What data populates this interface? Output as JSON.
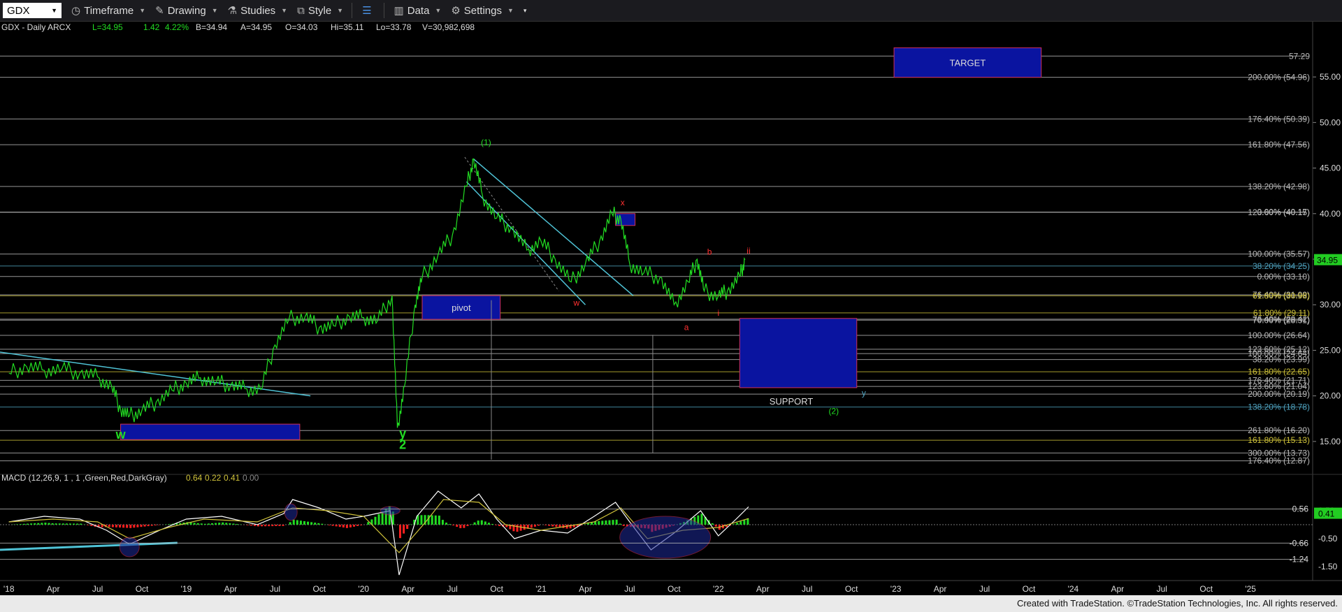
{
  "toolbar": {
    "symbol": "GDX",
    "timeframe": "Timeframe",
    "drawing": "Drawing",
    "studies": "Studies",
    "style": "Style",
    "data": "Data",
    "settings": "Settings"
  },
  "header": {
    "symbol_desc": "GDX - Daily  ARCX",
    "l": "L=34.95",
    "chg": "1.42",
    "pct": "4.22%",
    "b": "B=34.94",
    "a": "A=34.95",
    "o": "O=34.03",
    "hi": "Hi=35.11",
    "lo": "Lo=33.78",
    "v": "V=30,982,698"
  },
  "macd_header": {
    "label": "MACD (12,26,9, 1 , 1 ,Green,Red,DarkGray)",
    "v1": "0.64",
    "v2": "0.22",
    "v3": "0.41",
    "v4": "0.00"
  },
  "footer": "Created with TradeStation. ©TradeStation Technologies, Inc. All rights reserved.",
  "colors": {
    "price": "#22dd22",
    "fib_gray": "#bbbbbb",
    "fib_blue": "#4fa3c0",
    "fib_yellow": "#cfc23a",
    "box_blue": "#0a14a0",
    "wave_red": "#ff3030",
    "wave_green": "#22dd22"
  },
  "chart_data": [
    {
      "type": "line",
      "title": "GDX - Daily",
      "x_axis_labels": [
        "'18",
        "Apr",
        "Jul",
        "Oct",
        "'19",
        "Apr",
        "Jul",
        "Oct",
        "'20",
        "Apr",
        "Jul",
        "Oct",
        "'21",
        "Apr",
        "Jul",
        "Oct",
        "'22",
        "Apr",
        "Jul",
        "Oct",
        "'23",
        "Apr",
        "Jul",
        "Oct",
        "'24",
        "Apr",
        "Jul",
        "Oct",
        "'25"
      ],
      "y_ticks": [
        15,
        20,
        25,
        30,
        35,
        40,
        45,
        50,
        55
      ],
      "ylim": [
        12,
        58
      ],
      "last_price": "34.95",
      "series": [
        {
          "values_monthly": [
            [
              2018.0,
              22.5
            ],
            [
              2018.1,
              23.2
            ],
            [
              2018.2,
              22.8
            ],
            [
              2018.3,
              23.0
            ],
            [
              2018.4,
              22.5
            ],
            [
              2018.5,
              22.1
            ],
            [
              2018.58,
              21.0
            ],
            [
              2018.63,
              18.5
            ],
            [
              2018.68,
              17.8
            ],
            [
              2018.75,
              18.4
            ],
            [
              2018.83,
              19.3
            ],
            [
              2018.92,
              20.6
            ],
            [
              2019.0,
              21.4
            ],
            [
              2019.08,
              22.0
            ],
            [
              2019.17,
              21.5
            ],
            [
              2019.25,
              21.2
            ],
            [
              2019.33,
              20.8
            ],
            [
              2019.42,
              20.7
            ],
            [
              2019.5,
              25.6
            ],
            [
              2019.58,
              28.5
            ],
            [
              2019.67,
              28.7
            ],
            [
              2019.75,
              27.5
            ],
            [
              2019.83,
              27.7
            ],
            [
              2019.92,
              28.7
            ],
            [
              2020.0,
              28.6
            ],
            [
              2020.08,
              28.3
            ],
            [
              2020.16,
              31.0
            ],
            [
              2020.19,
              16.5
            ],
            [
              2020.23,
              21.0
            ],
            [
              2020.29,
              30.0
            ],
            [
              2020.33,
              33.0
            ],
            [
              2020.42,
              35.5
            ],
            [
              2020.5,
              37.6
            ],
            [
              2020.58,
              43.0
            ],
            [
              2020.62,
              46.0
            ],
            [
              2020.67,
              42.0
            ],
            [
              2020.75,
              39.5
            ],
            [
              2020.83,
              38.5
            ],
            [
              2020.92,
              36.0
            ],
            [
              2021.0,
              37.0
            ],
            [
              2021.08,
              35.0
            ],
            [
              2021.17,
              32.5
            ],
            [
              2021.25,
              34.5
            ],
            [
              2021.33,
              37.0
            ],
            [
              2021.4,
              40.0
            ],
            [
              2021.45,
              39.4
            ],
            [
              2021.5,
              34.5
            ],
            [
              2021.58,
              33.5
            ],
            [
              2021.67,
              33.0
            ],
            [
              2021.75,
              30.0
            ],
            [
              2021.83,
              32.5
            ],
            [
              2021.88,
              35.0
            ],
            [
              2021.92,
              31.5
            ],
            [
              2022.0,
              31.0
            ],
            [
              2022.05,
              31.5
            ],
            [
              2022.12,
              33.1
            ],
            [
              2022.15,
              34.95
            ]
          ]
        }
      ],
      "horizontal_levels": [
        {
          "label": "57.29",
          "value": 57.29,
          "color": "gray"
        },
        {
          "label": "200.00% (54.96)",
          "value": 54.96,
          "color": "gray"
        },
        {
          "label": "176.40% (50.39)",
          "value": 50.39,
          "color": "gray"
        },
        {
          "label": "161.80% (47.56)",
          "value": 47.56,
          "color": "gray"
        },
        {
          "label": "138.20% (42.98)",
          "value": 42.98,
          "color": "gray"
        },
        {
          "label": "123.60% (40.15)",
          "value": 40.15,
          "color": "gray"
        },
        {
          "label": "0.00% (40.17)",
          "value": 40.17,
          "color": "gray"
        },
        {
          "label": "100.00% (35.57)",
          "value": 35.57,
          "color": "gray"
        },
        {
          "label": "38.20% (34.25)",
          "value": 34.25,
          "color": "blue"
        },
        {
          "label": "0.00% (33.10)",
          "value": 33.1,
          "color": "gray"
        },
        {
          "label": "76.40% (31.09)",
          "value": 31.09,
          "color": "gray"
        },
        {
          "label": "61.80% (30.98)",
          "value": 30.98,
          "color": "yellow"
        },
        {
          "label": "61.80% (29.11)",
          "value": 29.11,
          "color": "yellow"
        },
        {
          "label": "76.40% (28.42)",
          "value": 28.42,
          "color": "gray"
        },
        {
          "label": "70.00% (28.31)",
          "value": 28.31,
          "color": "gray"
        },
        {
          "label": "100.00% (26.64)",
          "value": 26.64,
          "color": "gray"
        },
        {
          "label": "123.60% (25.12)",
          "value": 25.12,
          "color": "gray"
        },
        {
          "label": "100.00% (24.64)",
          "value": 24.64,
          "color": "gray"
        },
        {
          "label": "38.20% (23.99)",
          "value": 23.99,
          "color": "gray"
        },
        {
          "label": "161.80% (22.65)",
          "value": 22.65,
          "color": "yellow"
        },
        {
          "label": "176.40% (21.71)",
          "value": 21.71,
          "color": "gray"
        },
        {
          "label": "123.60% (21.04)",
          "value": 21.04,
          "color": "gray"
        },
        {
          "label": "200.00% (20.19)",
          "value": 20.19,
          "color": "gray"
        },
        {
          "label": "138.20% (18.78)",
          "value": 18.78,
          "color": "blue"
        },
        {
          "label": "261.80% (16.20)",
          "value": 16.2,
          "color": "gray"
        },
        {
          "label": "161.80% (15.13)",
          "value": 15.13,
          "color": "yellow"
        },
        {
          "label": "300.00% (13.73)",
          "value": 13.73,
          "color": "gray"
        },
        {
          "label": "176.40% (12.87)",
          "value": 12.87,
          "color": "gray"
        }
      ],
      "boxes": [
        {
          "label": "TARGET",
          "x0": 2022.99,
          "x1": 2023.82,
          "y0": 54.96,
          "y1": 58.2
        },
        {
          "label": "pivot",
          "x0": 2020.33,
          "x1": 2020.77,
          "y0": 28.4,
          "y1": 31.0
        },
        {
          "label": "",
          "x0": 2021.42,
          "x1": 2021.53,
          "y0": 38.7,
          "y1": 40.0
        },
        {
          "label": "SUPPORT",
          "x0": 2022.12,
          "x1": 2022.78,
          "y0": 20.9,
          "y1": 28.5
        },
        {
          "label": "",
          "x0": 2018.63,
          "x1": 2019.64,
          "y0": 15.2,
          "y1": 16.9
        }
      ],
      "wave_labels": [
        {
          "text": "(1)",
          "x": 2020.69,
          "y": 47.5,
          "color": "green"
        },
        {
          "text": "x",
          "x": 2021.46,
          "y": 40.9,
          "color": "red"
        },
        {
          "text": "w",
          "x": 2021.2,
          "y": 29.9,
          "color": "red"
        },
        {
          "text": "b",
          "x": 2021.95,
          "y": 35.5,
          "color": "red"
        },
        {
          "text": "ii",
          "x": 2022.17,
          "y": 35.6,
          "color": "red"
        },
        {
          "text": "a",
          "x": 2021.82,
          "y": 27.2,
          "color": "red"
        },
        {
          "text": "i",
          "x": 2022.0,
          "y": 28.8,
          "color": "red"
        },
        {
          "text": "y",
          "x": 2022.82,
          "y": 20.0,
          "color": "blue"
        },
        {
          "text": "(2)",
          "x": 2022.65,
          "y": 18.0,
          "color": "green"
        },
        {
          "text": "w",
          "x": 2018.63,
          "y": 15.3,
          "color": "green"
        },
        {
          "text": "y",
          "x": 2020.22,
          "y": 15.4,
          "color": "green"
        },
        {
          "text": "2",
          "x": 2020.22,
          "y": 14.2,
          "color": "green"
        }
      ]
    },
    {
      "type": "line",
      "title": "MACD (12,26,9, 1 , 1 ,Green,Red,DarkGray)",
      "y_ticks": [
        -1.5,
        -0.5,
        0.5
      ],
      "y_tick_labels": [
        "-1.50",
        "-0.50",
        "0.50"
      ],
      "ylim": [
        -1.8,
        1.3
      ],
      "level_labels": [
        "0.56",
        "-0.66",
        "-1.24"
      ],
      "last_value": "0.41",
      "series": [
        {
          "name": "MACD",
          "values": [
            [
              2018.0,
              0.1
            ],
            [
              2018.2,
              0.3
            ],
            [
              2018.4,
              0.2
            ],
            [
              2018.55,
              -0.2
            ],
            [
              2018.68,
              -0.7
            ],
            [
              2018.85,
              -0.2
            ],
            [
              2019.0,
              0.2
            ],
            [
              2019.2,
              0.3
            ],
            [
              2019.4,
              0.0
            ],
            [
              2019.55,
              0.4
            ],
            [
              2019.6,
              0.9
            ],
            [
              2019.75,
              0.6
            ],
            [
              2019.9,
              0.2
            ],
            [
              2020.0,
              0.3
            ],
            [
              2020.15,
              0.5
            ],
            [
              2020.2,
              -1.8
            ],
            [
              2020.3,
              0.3
            ],
            [
              2020.42,
              1.2
            ],
            [
              2020.55,
              0.6
            ],
            [
              2020.65,
              1.1
            ],
            [
              2020.75,
              0.2
            ],
            [
              2020.85,
              -0.5
            ],
            [
              2021.0,
              -0.2
            ],
            [
              2021.15,
              -0.3
            ],
            [
              2021.3,
              0.3
            ],
            [
              2021.42,
              0.8
            ],
            [
              2021.5,
              0.1
            ],
            [
              2021.62,
              -0.9
            ],
            [
              2021.75,
              -0.3
            ],
            [
              2021.9,
              0.5
            ],
            [
              2022.0,
              -0.4
            ],
            [
              2022.1,
              0.2
            ],
            [
              2022.17,
              0.64
            ]
          ]
        },
        {
          "name": "Signal",
          "values": [
            [
              2018.0,
              0.1
            ],
            [
              2018.25,
              0.2
            ],
            [
              2018.5,
              0.1
            ],
            [
              2018.68,
              -0.5
            ],
            [
              2018.9,
              -0.1
            ],
            [
              2019.1,
              0.2
            ],
            [
              2019.4,
              0.1
            ],
            [
              2019.6,
              0.6
            ],
            [
              2019.8,
              0.5
            ],
            [
              2020.0,
              0.3
            ],
            [
              2020.2,
              -1.0
            ],
            [
              2020.35,
              0.1
            ],
            [
              2020.45,
              0.9
            ],
            [
              2020.65,
              0.8
            ],
            [
              2020.8,
              0.0
            ],
            [
              2021.0,
              -0.2
            ],
            [
              2021.3,
              0.1
            ],
            [
              2021.45,
              0.6
            ],
            [
              2021.6,
              -0.5
            ],
            [
              2021.8,
              -0.2
            ],
            [
              2022.0,
              -0.1
            ],
            [
              2022.17,
              0.22
            ]
          ]
        }
      ]
    }
  ]
}
